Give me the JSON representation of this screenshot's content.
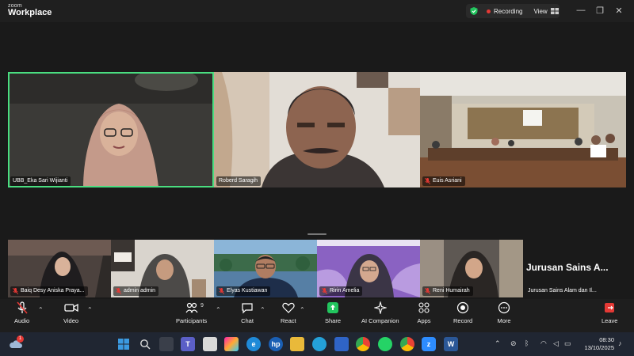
{
  "titlebar": {
    "brand_top": "zoom",
    "brand_bottom": "Workplace",
    "recording_label": "Recording",
    "view_label": "View",
    "minimize": "—",
    "restore": "❐",
    "close": "✕"
  },
  "participants_top": [
    {
      "name": "UBB_Eka Sari Wijianti"
    },
    {
      "name": "Roberd Saragih"
    },
    {
      "name": "Euis Asriani"
    }
  ],
  "participants_bottom": [
    {
      "name": "Baiq Desy Aniska Praya..."
    },
    {
      "name": "admin admin"
    },
    {
      "name": "Elyas Kustiawan"
    },
    {
      "name": "Ririn Amelia"
    },
    {
      "name": "Reni Humairah"
    }
  ],
  "text_tile": {
    "big": "Jurusan Sains A...",
    "name": "Jurusan Sains Alam dan Il..."
  },
  "toolbar": {
    "audio": "Audio",
    "video": "Video",
    "participants": "Participants",
    "participants_count": "9",
    "chat": "Chat",
    "react": "React",
    "share": "Share",
    "ai_companion": "AI Companion",
    "apps": "Apps",
    "record": "Record",
    "more": "More",
    "leave": "Leave"
  },
  "taskbar": {
    "weather_badge": "1",
    "time": "08:30",
    "date": "13/10/2025"
  },
  "colors": {
    "active_speaker": "#4ade80",
    "share_green": "#22c55e",
    "recording_red": "#e53935",
    "leave_red": "#e53935"
  }
}
